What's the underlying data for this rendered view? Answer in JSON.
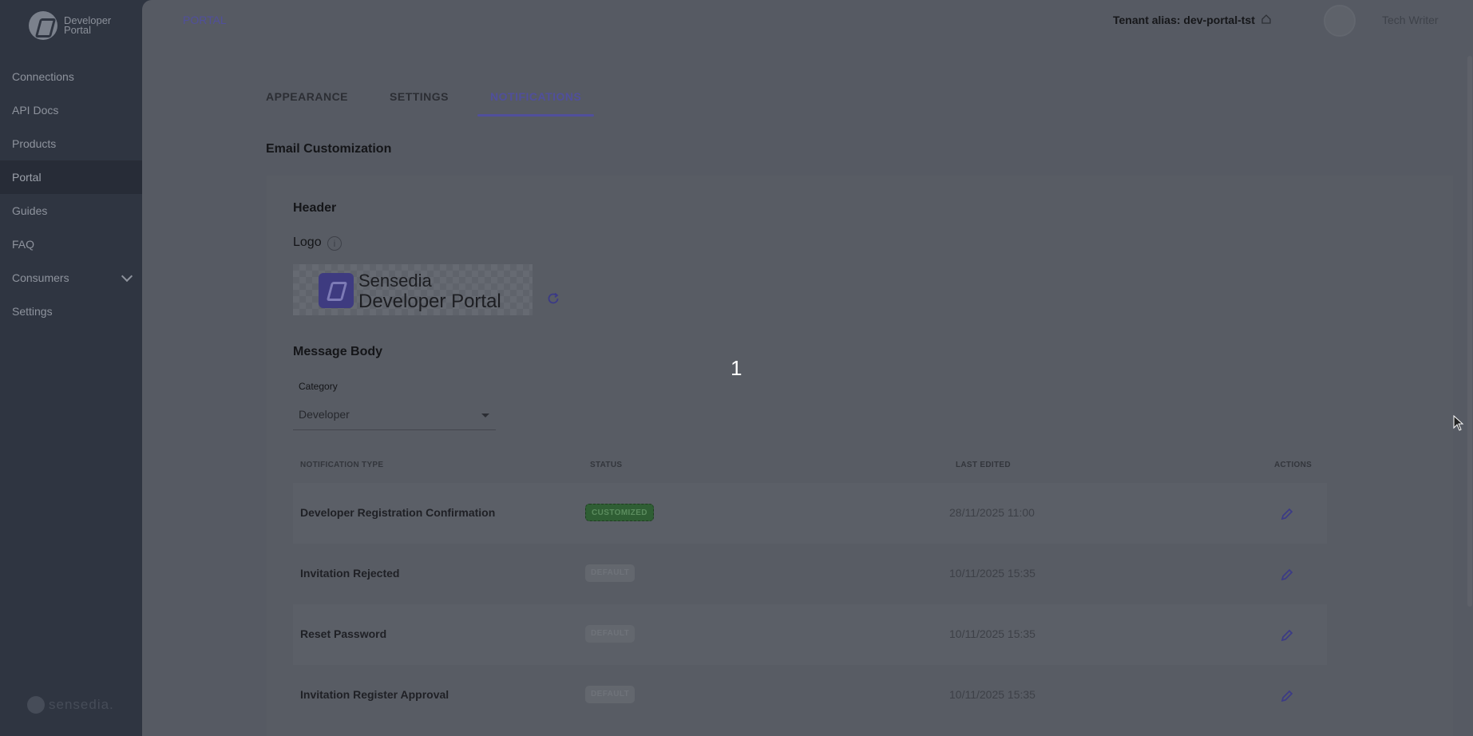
{
  "brand": {
    "line1": "Developer",
    "line2": "Portal",
    "footer": "sensedia."
  },
  "sidebar": {
    "items": [
      {
        "label": "Connections"
      },
      {
        "label": "API Docs"
      },
      {
        "label": "Products"
      },
      {
        "label": "Portal",
        "active": true
      },
      {
        "label": "Guides"
      },
      {
        "label": "FAQ"
      },
      {
        "label": "Consumers",
        "expandable": true
      },
      {
        "label": "Settings"
      }
    ]
  },
  "header": {
    "breadcrumb": "PORTAL",
    "tenant": "Tenant alias: dev-portal-tst",
    "user": "Tech Writer"
  },
  "tabs": [
    {
      "label": "APPEARANCE"
    },
    {
      "label": "SETTINGS"
    },
    {
      "label": "NOTIFICATIONS",
      "active": true
    }
  ],
  "email": {
    "title": "Email Customization",
    "header_label": "Header",
    "logo_label": "Logo",
    "logo_text_1": "Sensedia",
    "logo_text_2": "Developer Portal",
    "body_label": "Message Body",
    "category_label": "Category",
    "category_value": "Developer"
  },
  "table": {
    "columns": [
      "NOTIFICATION TYPE",
      "STATUS",
      "LAST EDITED",
      "ACTIONS"
    ],
    "rows": [
      {
        "type": "Developer Registration Confirmation",
        "status": "CUSTOMIZED",
        "edited": "28/11/2025 11:00"
      },
      {
        "type": "Invitation Rejected",
        "status": "DEFAULT",
        "edited": "10/11/2025 15:35"
      },
      {
        "type": "Reset Password",
        "status": "DEFAULT",
        "edited": "10/11/2025 15:35"
      },
      {
        "type": "Invitation Register Approval",
        "status": "DEFAULT",
        "edited": "10/11/2025 15:35"
      }
    ]
  },
  "overlay": {
    "marker": "1"
  },
  "colors": {
    "accent": "#504f9c",
    "sidebar": "#2f3541",
    "customized": "#2f5e34"
  }
}
